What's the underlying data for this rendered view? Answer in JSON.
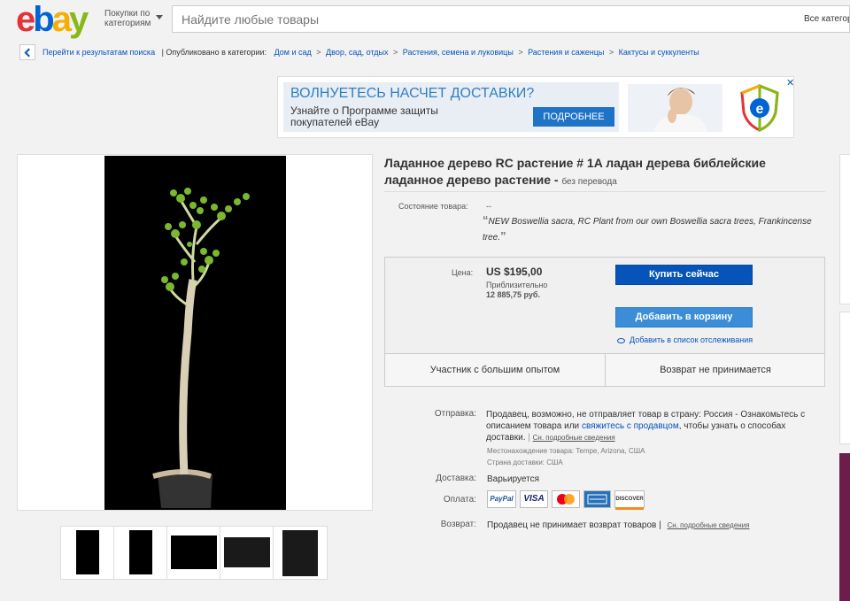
{
  "header": {
    "logo_letters": [
      "e",
      "b",
      "a",
      "y"
    ],
    "category_button": "Покупки по категориям",
    "search_placeholder": "Найдите любые товары",
    "all_categories": "Все категории"
  },
  "breadcrumb": {
    "back_label": "Перейти к результатам поиска",
    "published_in": "| Опубликовано в категории:",
    "items": [
      "Дом и сад",
      "Двор, сад, отдых",
      "Растения, семена и луковицы",
      "Растения и саженцы",
      "Кактусы и суккуленты"
    ],
    "separator": ">"
  },
  "banner": {
    "headline": "ВОЛНУЕТЕСЬ НАСЧЕТ ДОСТАВКИ?",
    "sub": "Узнайте о Программе защиты покупателей eBay",
    "button": "ПОДРОБНЕЕ"
  },
  "listing": {
    "title": "Ладанное дерево RC растение # 1A ладан дерева библейские ладанное дерево растение -",
    "no_translation": "без перевода",
    "condition_label": "Состояние товара:",
    "condition_value": "--",
    "quote": "NEW Boswellia sacra, RC Plant from our own Boswellia sacra trees, Frankincense tree."
  },
  "price": {
    "label": "Цена:",
    "value": "US $195,00",
    "approx_label": "Приблизительно",
    "rub": "12 885,75 руб.",
    "buy_now": "Купить сейчас",
    "add_to_cart": "Добавить в корзину",
    "watch": "Добавить в список отслеживания",
    "seller_badge": "Участник с большим опытом",
    "returns_badge": "Возврат не принимается"
  },
  "shipping": {
    "label": "Отправка:",
    "text_1": "Продавец, возможно, не отправляет товар в страну: Россия - Ознакомьтесь с описанием товара или",
    "contact_link": "свяжитесь с продавцом",
    "text_2": ", чтобы узнать о способах доставки.",
    "details_link": "Сн. подробные сведения",
    "location": "Местонахождение товара:  Tempe, Arizona, США",
    "ships_to": "Страна доставки:  США"
  },
  "delivery": {
    "label": "Доставка:",
    "value": "Варьируется"
  },
  "payment": {
    "label": "Оплата:",
    "methods": [
      "PayPal",
      "VISA",
      "MasterCard",
      "AMEX",
      "DISCOVER"
    ]
  },
  "returns": {
    "label": "Возврат:",
    "value": "Продавец не принимает возврат товаров |",
    "details_link": "Сн. подробные сведения"
  },
  "colors": {
    "ebay_blue": "#0654ba",
    "cart_blue": "#3a8dd6",
    "banner_blue": "#2f7fc4"
  }
}
